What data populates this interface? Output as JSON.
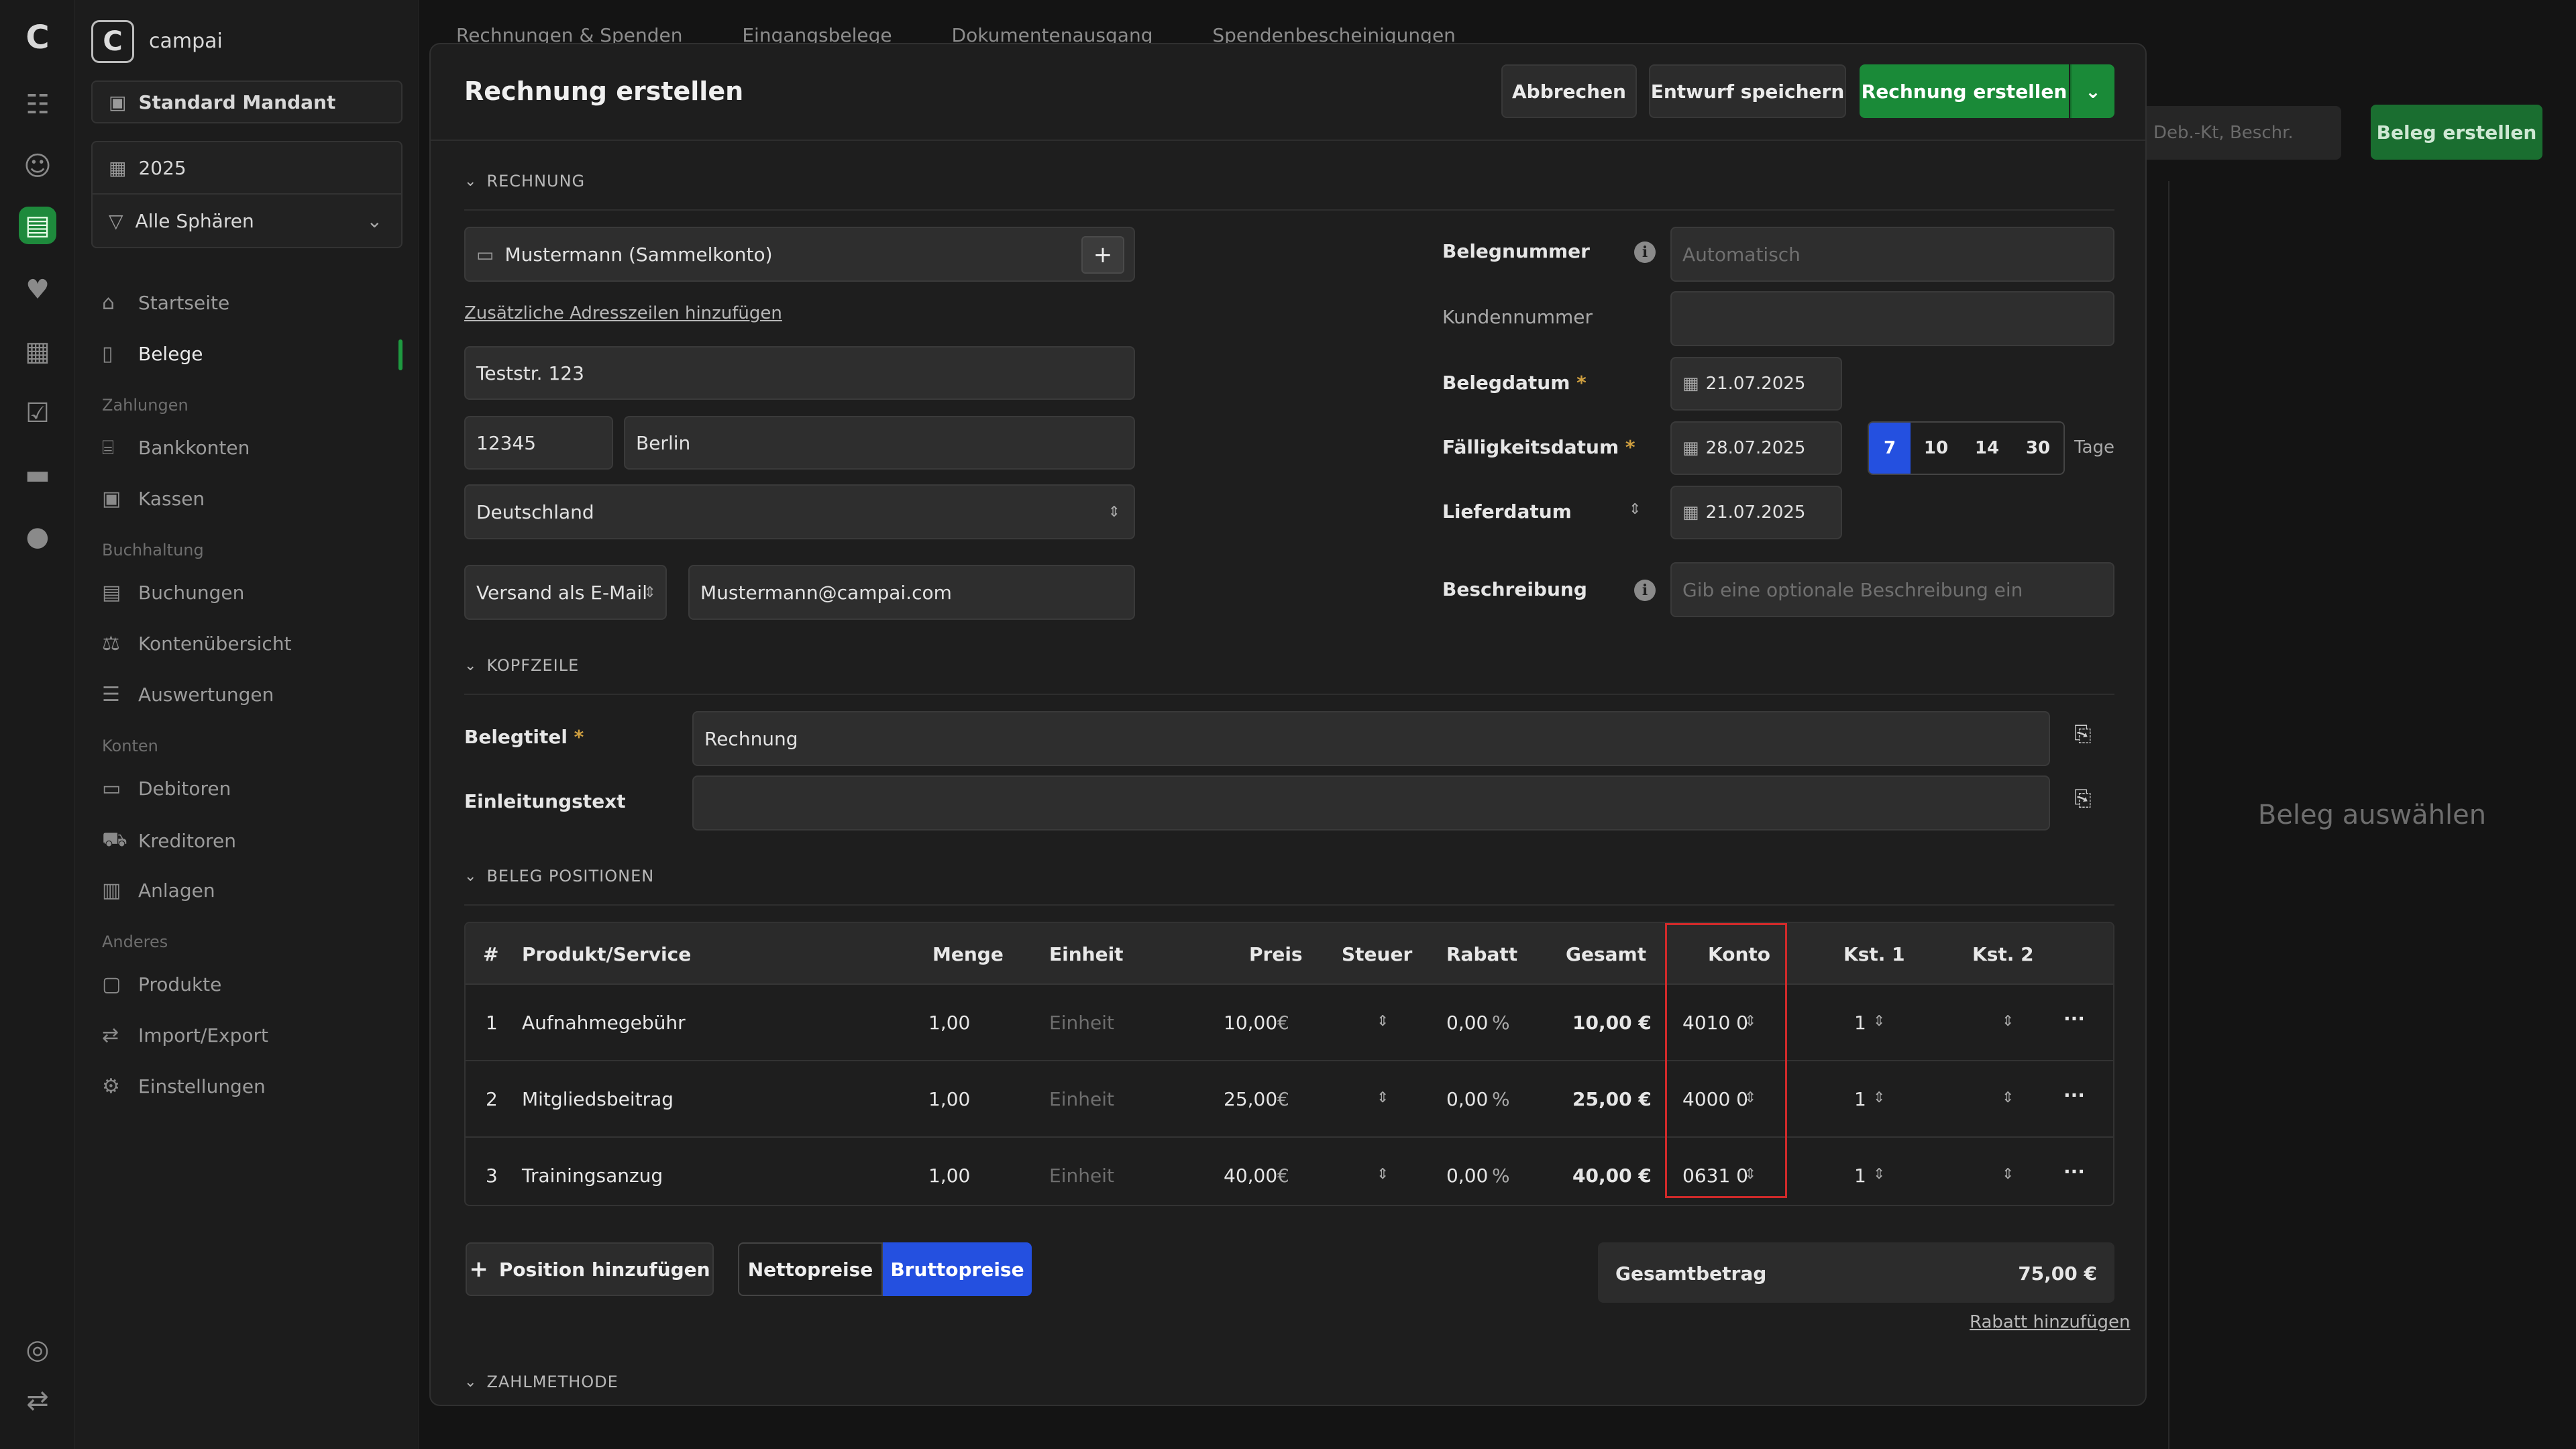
{
  "app": {
    "name": "campai"
  },
  "sidebar": {
    "mandant": "Standard Mandant",
    "year": "2025",
    "sphere": "Alle Sphären",
    "items": {
      "startseite": "Startseite",
      "belege": "Belege",
      "zahlungen": "Zahlungen",
      "bankkonten": "Bankkonten",
      "kassen": "Kassen",
      "buchhaltung": "Buchhaltung",
      "buchungen": "Buchungen",
      "kontenuebersicht": "Kontenübersicht",
      "auswertungen": "Auswertungen",
      "konten": "Konten",
      "debitoren": "Debitoren",
      "kreditoren": "Kreditoren",
      "anlagen": "Anlagen",
      "anderes": "Anderes",
      "produkte": "Produkte",
      "import_export": "Import/Export",
      "einstellungen": "Einstellungen"
    }
  },
  "background": {
    "tabs": [
      "Rechnungen & Spenden",
      "Eingangsbelege",
      "Dokumentenausgang",
      "Spendenbescheinigungen"
    ],
    "search_placeholder": "Deb.-Kt, Beschr.",
    "create_button": "Beleg erstellen",
    "empty_state": "Beleg auswählen"
  },
  "modal": {
    "title": "Rechnung erstellen",
    "cancel": "Abbrechen",
    "save_draft": "Entwurf speichern",
    "create": "Rechnung erstellen",
    "section_rechnung": "RECHNUNG",
    "customer": "Mustermann (Sammelkonto)",
    "add_address": "Zusätzliche Adresszeilen hinzufügen",
    "street": "Teststr. 123",
    "zip": "12345",
    "city": "Berlin",
    "country": "Deutschland",
    "dispatch": "Versand als E-Mail",
    "email": "Mustermann@campai.com",
    "belegnummer_label": "Belegnummer",
    "belegnummer_placeholder": "Automatisch",
    "kundennummer_label": "Kundennummer",
    "belegdatum_label": "Belegdatum",
    "belegdatum": "21.07.2025",
    "faellig_label": "Fälligkeitsdatum",
    "faellig": "28.07.2025",
    "days": [
      "7",
      "10",
      "14",
      "30"
    ],
    "days_suffix": "Tage",
    "lieferdatum_label": "Lieferdatum",
    "lieferdatum": "21.07.2025",
    "beschreibung_label": "Beschreibung",
    "beschreibung_placeholder": "Gib eine optionale Beschreibung ein",
    "section_kopfzeile": "KOPFZEILE",
    "belegtitel_label": "Belegtitel",
    "belegtitel": "Rechnung",
    "einleitung_label": "Einleitungstext",
    "section_positionen": "BELEG POSITIONEN",
    "columns": {
      "num": "#",
      "product": "Produkt/Service",
      "menge": "Menge",
      "einheit": "Einheit",
      "preis": "Preis",
      "steuer": "Steuer",
      "rabatt": "Rabatt",
      "gesamt": "Gesamt",
      "konto": "Konto",
      "kst1": "Kst. 1",
      "kst2": "Kst. 2"
    },
    "rows": [
      {
        "num": "1",
        "product": "Aufnahmegebühr",
        "menge": "1,00",
        "einheit": "Einheit",
        "preis": "10,00",
        "cur": "€",
        "rabatt": "0,00",
        "pct": "%",
        "gesamt": "10,00 €",
        "konto": "4010 0",
        "kst1": "1"
      },
      {
        "num": "2",
        "product": "Mitgliedsbeitrag",
        "menge": "1,00",
        "einheit": "Einheit",
        "preis": "25,00",
        "cur": "€",
        "rabatt": "0,00",
        "pct": "%",
        "gesamt": "25,00 €",
        "konto": "4000 0",
        "kst1": "1"
      },
      {
        "num": "3",
        "product": "Trainingsanzug",
        "menge": "1,00",
        "einheit": "Einheit",
        "preis": "40,00",
        "cur": "€",
        "rabatt": "0,00",
        "pct": "%",
        "gesamt": "40,00 €",
        "konto": "0631 0",
        "kst1": "1"
      }
    ],
    "add_position": "Position hinzufügen",
    "netto": "Nettopreise",
    "brutto": "Bruttopreise",
    "gesamtbetrag_label": "Gesamtbetrag",
    "gesamtbetrag": "75,00 €",
    "add_discount": "Rabatt hinzufügen",
    "section_zahlmethode": "ZAHLMETHODE"
  },
  "colors": {
    "accent_green": "#1a8a38",
    "accent_blue": "#2450e0",
    "highlight_red": "#d02a2a"
  }
}
